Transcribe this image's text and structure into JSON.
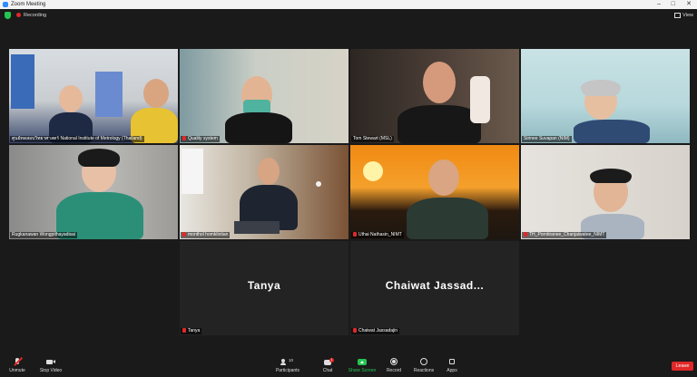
{
  "window": {
    "title": "Zoom Meeting",
    "controls": [
      "–",
      "□",
      "✕"
    ]
  },
  "topbar": {
    "recording_label": "Recording",
    "view_label": "View"
  },
  "participants": [
    {
      "name": "ศูนย์ทดสอบวิทยาศาสตร์ National Institute of Metrology (Thailand)",
      "muted": false,
      "active": false
    },
    {
      "name": "Quality system",
      "muted": true,
      "active": false
    },
    {
      "name": "Tom Stewart (MSL)",
      "muted": false,
      "active": false
    },
    {
      "name": "Sirinee Suvapan (NIM)",
      "muted": false,
      "active": false
    },
    {
      "name": "Rugkanawan Wongpithayadisai",
      "muted": false,
      "active": true
    },
    {
      "name": "monthol homklintian",
      "muted": true,
      "active": false
    },
    {
      "name": "Uthai Nathasin_NIMT",
      "muted": true,
      "active": false
    },
    {
      "name": "TH_Porntiranee_Chanjaiwatee_NIMT",
      "muted": true,
      "active": false
    },
    {
      "name": "Tanya",
      "display": "Tanya",
      "muted": true,
      "active": false
    },
    {
      "name": "Chaiwat Jassadajin",
      "display": "Chaiwat  Jassad...",
      "muted": true,
      "active": false
    }
  ],
  "toolbar": {
    "unmute": "Unmute",
    "stop_video": "Stop Video",
    "participants": "Participants",
    "participants_count": "10",
    "chat": "Chat",
    "chat_badge": "1",
    "share_screen": "Share Screen",
    "record": "Record",
    "reactions": "Reactions",
    "apps": "Apps",
    "leave": "Leave"
  },
  "colors": {
    "accent_green": "#23c552",
    "leave_red": "#e02828",
    "active_border": "#e3d44a"
  }
}
